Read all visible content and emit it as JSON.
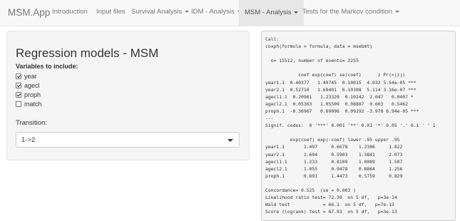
{
  "navbar": {
    "brand": "MSM.App",
    "items": [
      {
        "label": "Introduction"
      },
      {
        "label": "Input files"
      },
      {
        "label": "Survival Analysis"
      },
      {
        "label": "IDM - Analysis"
      },
      {
        "label": "MSM - Analysis"
      },
      {
        "label": "Tests for the Markov condition"
      }
    ]
  },
  "sidebar": {
    "title": "Regression models - MSM",
    "variables_label": "Variables to include:",
    "checkboxes": [
      {
        "label": "year",
        "checked": true
      },
      {
        "label": "agecl",
        "checked": true
      },
      {
        "label": "proph",
        "checked": true
      },
      {
        "label": "match",
        "checked": false
      }
    ],
    "transition_label": "Transition:",
    "transition_value": "1->2"
  },
  "output": {
    "lines": [
      "Call:",
      "coxph(formula = formula, data = msebmt)",
      "",
      "  n= 15512, number of events= 3255",
      "",
      "            coef exp(coef) se(coef)      z Pr(>|z|)",
      "year1.1  0.40377   1.49745  0.10015  4.032 5.54e-05 ***",
      "year2.1  0.52710   1.69401  0.10308  5.114 3.16e-07 ***",
      "agecl1.1  0.20961   1.23320  0.10242  2.047   0.0407 *",
      "agecl2.1  0.05363   1.05509  0.08887  0.603   0.5462",
      "proph.1  -0.36967   0.69096  0.09292 -3.978 6.94e-05 ***",
      "---",
      "Signif. codes:  0 '***' 0.001 '**' 0.01 '*' 0.05 '.' 0.1 ' ' 1",
      "",
      "         exp(coef) exp(-coef) lower .95 upper .95",
      "year1.1       1.497     0.6678    1.2306     1.822",
      "year2.1       1.694     0.5903    1.3841     2.073",
      "agecl1.1      1.233     0.8109    1.0089     1.507",
      "agecl2.1      1.055     0.9478    0.8864     1.256",
      "proph.1       0.691     1.4473    0.5759     0.829",
      "",
      "Concordance= 0.525  (se = 0.003 )",
      "Likelihood ratio test= 72.39  on 5 df,   p=3e-14",
      "Wald test            = 66.1  on 5 df,   p=7e-13",
      "Score (logrank) test = 67.93  on 5 df,   p=3e-13"
    ]
  }
}
